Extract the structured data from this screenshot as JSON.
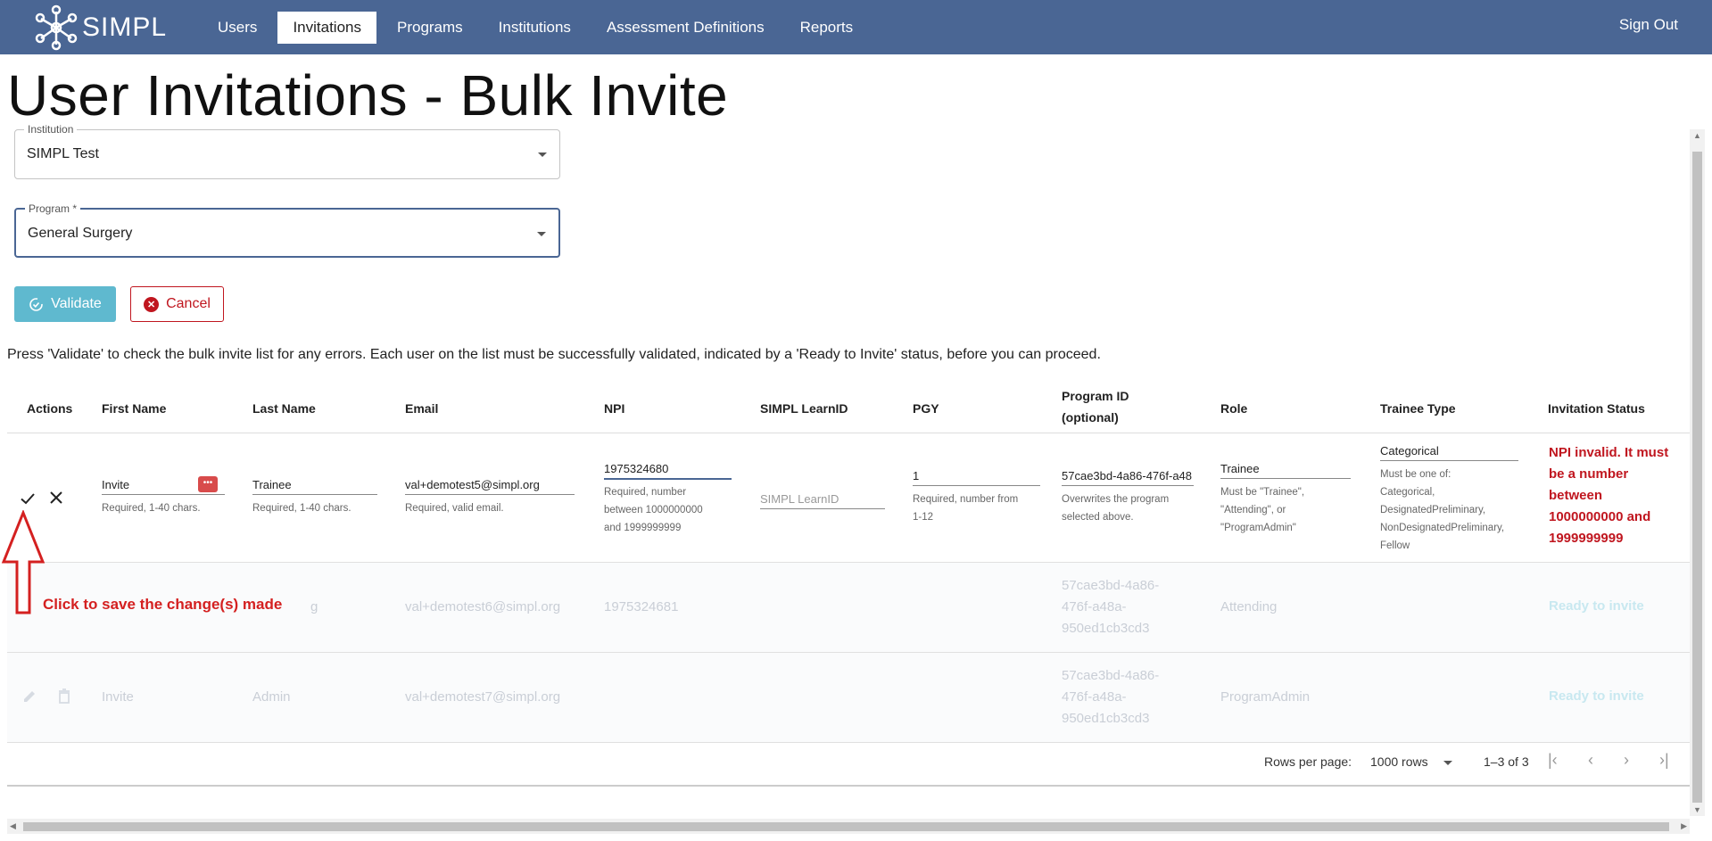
{
  "nav": {
    "logo_text": "SIMPL",
    "items": [
      {
        "label": "Users"
      },
      {
        "label": "Invitations"
      },
      {
        "label": "Programs"
      },
      {
        "label": "Institutions"
      },
      {
        "label": "Assessment Definitions"
      },
      {
        "label": "Reports"
      }
    ],
    "active": "Invitations",
    "sign_out": "Sign Out",
    "bar_color": "#4a6694"
  },
  "page_title": "User Invitations - Bulk Invite",
  "institution": {
    "label": "Institution",
    "value": "SIMPL Test"
  },
  "program": {
    "label": "Program *",
    "value": "General Surgery"
  },
  "buttons": {
    "validate": "Validate",
    "cancel": "Cancel"
  },
  "instructions": "Press 'Validate' to check the bulk invite list for any errors. Each user on the list must be successfully validated, indicated by a 'Ready to Invite' status, before you can proceed.",
  "table": {
    "headers": {
      "actions": "Actions",
      "first_name": "First Name",
      "last_name": "Last Name",
      "email": "Email",
      "npi": "NPI",
      "learnid": "SIMPL LearnID",
      "pgy": "PGY",
      "program_id": "Program ID",
      "program_id_sub": "(optional)",
      "role": "Role",
      "trainee_type": "Trainee Type",
      "status": "Invitation Status"
    },
    "edit_row": {
      "first_name": "Invite",
      "first_name_help": "Required, 1-40 chars.",
      "last_name": "Trainee",
      "last_name_help": "Required, 1-40 chars.",
      "email": "val+demotest5@simpl.org",
      "email_help": "Required, valid email.",
      "npi": "1975324680",
      "npi_help_1": "Required, number",
      "npi_help_2": "between 1000000000",
      "npi_help_3": "and 1999999999",
      "learnid_placeholder": "SIMPL LearnID",
      "pgy": "1",
      "pgy_help_1": "Required, number from",
      "pgy_help_2": "1-12",
      "program_id": "57cae3bd-4a86-476f-a48",
      "program_id_help_1": "Overwrites the program",
      "program_id_help_2": "selected above.",
      "role": "Trainee",
      "role_help_1": "Must be \"Trainee\",",
      "role_help_2": "\"Attending\", or",
      "role_help_3": "\"ProgramAdmin\"",
      "trainee_type": "Categorical",
      "tt_help_1": "Must be one of:",
      "tt_help_2": "Categorical,",
      "tt_help_3": "DesignatedPreliminary,",
      "tt_help_4": "NonDesignatedPreliminary,",
      "tt_help_5": "Fellow",
      "status_1": "NPI invalid. It must",
      "status_2": "be a number",
      "status_3": "between",
      "status_4": "1000000000 and",
      "status_5": "1999999999"
    },
    "rows": [
      {
        "first_name": "",
        "last_name": "g",
        "email": "val+demotest6@simpl.org",
        "npi": "1975324681",
        "program_id_1": "57cae3bd-4a86-",
        "program_id_2": "476f-a48a-",
        "program_id_3": "950ed1cb3cd3",
        "role": "Attending",
        "status": "Ready to invite"
      },
      {
        "first_name": "Invite",
        "last_name": "Admin",
        "email": "val+demotest7@simpl.org",
        "npi": "",
        "program_id_1": "57cae3bd-4a86-",
        "program_id_2": "476f-a48a-",
        "program_id_3": "950ed1cb3cd3",
        "role": "ProgramAdmin",
        "status": "Ready to invite"
      }
    ],
    "pagination": {
      "rows_per_page_label": "Rows per page:",
      "rows_per_page_value": "1000 rows",
      "range": "1–3 of 3"
    }
  },
  "annotation": {
    "text": "Click to save the change(s) made",
    "color": "#d42020"
  },
  "icons": [
    "logo-molecule-icon",
    "check-icon",
    "close-icon",
    "password-dots-icon",
    "validate-icon",
    "cancel-circle-icon",
    "edit-pencil-icon",
    "delete-trash-icon",
    "first-page-icon",
    "prev-page-icon",
    "next-page-icon",
    "last-page-icon"
  ]
}
